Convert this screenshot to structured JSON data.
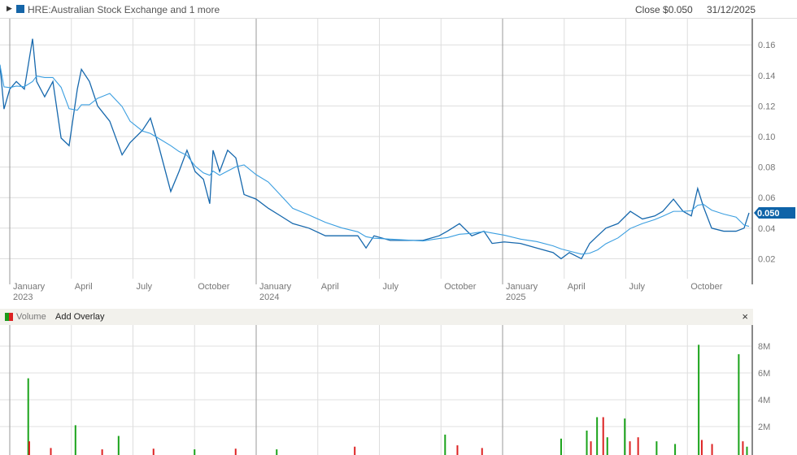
{
  "header": {
    "expand_icon": "triangle-right",
    "series_label": "HRE:Australian Stock Exchange and 1 more",
    "close": "Close $0.050",
    "date": "31/12/2025"
  },
  "volume_header": {
    "label": "Volume",
    "add_overlay": "Add Overlay",
    "close_icon": "×"
  },
  "colors": {
    "price": "#1668ad",
    "ma": "#3a9ee0",
    "up": "#1aa31a",
    "down": "#dd2222",
    "label_bg": "#0e63a8"
  },
  "chart_data": [
    {
      "type": "line",
      "title": "HRE price",
      "x_unit": "months since Jan 2023",
      "ylim": [
        0,
        0.17
      ],
      "y_ticks": [
        "0.16",
        "0.14",
        "0.12",
        "0.10",
        "0.08",
        "0.06",
        "0.04",
        "0.02"
      ],
      "last_value_label": "0.050",
      "x_ticks": [
        {
          "m": 0,
          "l1": "January",
          "l2": "2023"
        },
        {
          "m": 3,
          "l1": "April",
          "l2": ""
        },
        {
          "m": 6,
          "l1": "July",
          "l2": ""
        },
        {
          "m": 9,
          "l1": "October",
          "l2": ""
        },
        {
          "m": 12,
          "l1": "January",
          "l2": "2024"
        },
        {
          "m": 15,
          "l1": "April",
          "l2": ""
        },
        {
          "m": 18,
          "l1": "July",
          "l2": ""
        },
        {
          "m": 21,
          "l1": "October",
          "l2": ""
        },
        {
          "m": 24,
          "l1": "January",
          "l2": "2025"
        },
        {
          "m": 27,
          "l1": "April",
          "l2": ""
        },
        {
          "m": 30,
          "l1": "July",
          "l2": ""
        },
        {
          "m": 33,
          "l1": "October",
          "l2": ""
        }
      ],
      "price": [
        [
          -0.48,
          0.147
        ],
        [
          -0.28,
          0.118
        ],
        [
          0,
          0.131
        ],
        [
          0.32,
          0.136
        ],
        [
          0.71,
          0.131
        ],
        [
          1.11,
          0.164
        ],
        [
          1.31,
          0.136
        ],
        [
          1.7,
          0.126
        ],
        [
          2.1,
          0.136
        ],
        [
          2.5,
          0.099
        ],
        [
          2.89,
          0.094
        ],
        [
          3.29,
          0.131
        ],
        [
          3.49,
          0.144
        ],
        [
          3.88,
          0.136
        ],
        [
          4.28,
          0.12
        ],
        [
          4.87,
          0.11
        ],
        [
          5.47,
          0.088
        ],
        [
          5.86,
          0.096
        ],
        [
          6.46,
          0.104
        ],
        [
          6.85,
          0.112
        ],
        [
          7.25,
          0.094
        ],
        [
          7.84,
          0.064
        ],
        [
          8.24,
          0.077
        ],
        [
          8.63,
          0.091
        ],
        [
          9.03,
          0.077
        ],
        [
          9.43,
          0.072
        ],
        [
          9.74,
          0.056
        ],
        [
          9.9,
          0.091
        ],
        [
          10.22,
          0.077
        ],
        [
          10.61,
          0.091
        ],
        [
          11.01,
          0.086
        ],
        [
          11.41,
          0.062
        ],
        [
          12,
          0.059
        ],
        [
          12.59,
          0.053
        ],
        [
          13.19,
          0.048
        ],
        [
          13.78,
          0.043
        ],
        [
          14.57,
          0.04
        ],
        [
          15.37,
          0.035
        ],
        [
          16.16,
          0.035
        ],
        [
          16.95,
          0.035
        ],
        [
          17.35,
          0.027
        ],
        [
          17.74,
          0.035
        ],
        [
          18.53,
          0.032
        ],
        [
          19.33,
          0.032
        ],
        [
          20.12,
          0.032
        ],
        [
          20.91,
          0.035
        ],
        [
          21.31,
          0.038
        ],
        [
          21.9,
          0.043
        ],
        [
          22.5,
          0.035
        ],
        [
          23.09,
          0.038
        ],
        [
          23.49,
          0.03
        ],
        [
          24.08,
          0.031
        ],
        [
          24.87,
          0.03
        ],
        [
          25.66,
          0.027
        ],
        [
          26.46,
          0.024
        ],
        [
          26.85,
          0.02
        ],
        [
          27.25,
          0.024
        ],
        [
          27.84,
          0.02
        ],
        [
          28.24,
          0.03
        ],
        [
          28.63,
          0.035
        ],
        [
          29.03,
          0.04
        ],
        [
          29.62,
          0.043
        ],
        [
          30.22,
          0.051
        ],
        [
          30.81,
          0.046
        ],
        [
          31.41,
          0.048
        ],
        [
          31.8,
          0.051
        ],
        [
          32.32,
          0.059
        ],
        [
          32.79,
          0.051
        ],
        [
          33.19,
          0.048
        ],
        [
          33.5,
          0.066
        ],
        [
          33.78,
          0.054
        ],
        [
          34.18,
          0.04
        ],
        [
          34.77,
          0.038
        ],
        [
          35.37,
          0.038
        ],
        [
          35.76,
          0.04
        ],
        [
          36,
          0.05
        ]
      ]
    },
    {
      "type": "bar",
      "title": "Volume",
      "y_ticks": [
        "8M",
        "6M",
        "4M",
        "2M"
      ],
      "ylim": [
        0,
        9000000
      ],
      "bars": [
        [
          0.9,
          5600000,
          "up"
        ],
        [
          0.95,
          900000,
          "down"
        ],
        [
          3.2,
          2100000,
          "up"
        ],
        [
          5.3,
          1300000,
          "up"
        ],
        [
          2,
          400000,
          "down"
        ],
        [
          4.5,
          300000,
          "down"
        ],
        [
          7,
          350000,
          "down"
        ],
        [
          9,
          300000,
          "up"
        ],
        [
          11,
          350000,
          "down"
        ],
        [
          13,
          300000,
          "up"
        ],
        [
          16.8,
          500000,
          "down"
        ],
        [
          21.2,
          1400000,
          "up"
        ],
        [
          21.8,
          600000,
          "down"
        ],
        [
          23,
          400000,
          "down"
        ],
        [
          26.85,
          1100000,
          "up"
        ],
        [
          28.1,
          1700000,
          "up"
        ],
        [
          28.3,
          900000,
          "down"
        ],
        [
          28.6,
          2700000,
          "up"
        ],
        [
          28.9,
          2700000,
          "down"
        ],
        [
          29.1,
          1200000,
          "up"
        ],
        [
          29.95,
          2600000,
          "up"
        ],
        [
          30.2,
          900000,
          "down"
        ],
        [
          30.6,
          1200000,
          "down"
        ],
        [
          31.5,
          900000,
          "up"
        ],
        [
          32.4,
          700000,
          "up"
        ],
        [
          33.55,
          8100000,
          "up"
        ],
        [
          33.7,
          1000000,
          "down"
        ],
        [
          34.2,
          700000,
          "down"
        ],
        [
          35.5,
          7400000,
          "up"
        ],
        [
          35.7,
          900000,
          "down"
        ],
        [
          35.9,
          500000,
          "up"
        ]
      ]
    }
  ]
}
